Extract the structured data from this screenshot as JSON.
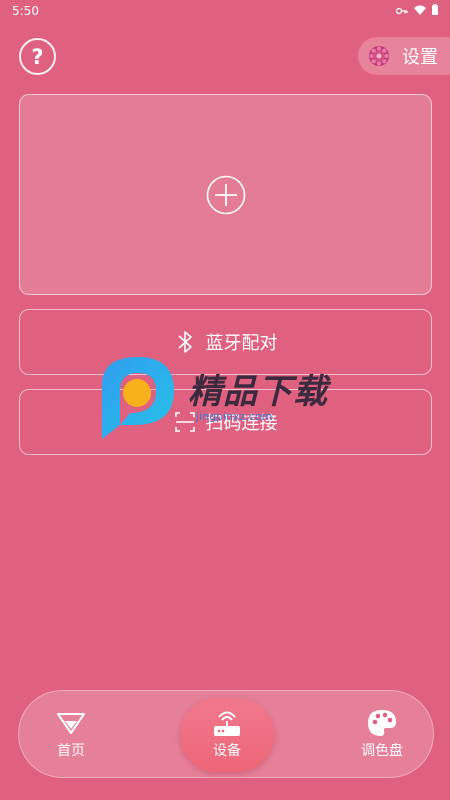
{
  "status_bar": {
    "time": "5:50",
    "icons": [
      "key-icon",
      "wifi-icon",
      "battery-icon"
    ]
  },
  "header": {
    "help_label": "?",
    "settings_label": "设置",
    "settings_icon": "gear-icon"
  },
  "main": {
    "add_card_icon": "plus-circle-icon",
    "options": [
      {
        "label": "蓝牙配对",
        "icon": "bluetooth-icon"
      },
      {
        "label": "扫码连接",
        "icon": "scan-icon"
      }
    ]
  },
  "watermark": {
    "text": "精品下载",
    "subtext": "jingpinxz.com"
  },
  "bottom_nav": {
    "items": [
      {
        "label": "首页",
        "icon": "home-diamond-icon"
      },
      {
        "label": "设备",
        "icon": "router-icon",
        "selected": true
      },
      {
        "label": "调色盘",
        "icon": "palette-icon"
      }
    ]
  },
  "colors": {
    "background": "#e0607f",
    "selected_nav": "#ef6f82",
    "text": "#ffffff"
  }
}
